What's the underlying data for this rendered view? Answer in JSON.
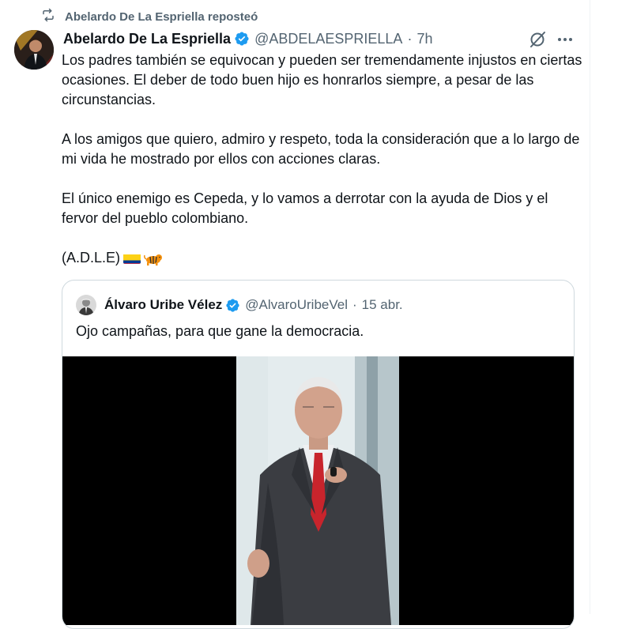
{
  "repost": {
    "label": "Abelardo De La Espriella reposteó",
    "icon": "repost-icon"
  },
  "tweet": {
    "author_name": "Abelardo De La Espriella",
    "handle": "@ABDELAESPRIELLA",
    "separator": "·",
    "time": "7h",
    "paragraphs": [
      "Los padres también se equivocan y pueden ser tremendamente injustos en ciertas ocasiones. El deber de todo buen hijo es honrarlos siempre, a pesar de las circunstancias.",
      "A los amigos que quiero, admiro y respeto, toda la consideración que a lo largo de mi vida he mostrado por ellos con acciones claras.",
      "El único enemigo es Cepeda, y lo vamos a derrotar con la ayuda de Dios y el fervor del pueblo colombiano."
    ],
    "signature": "(A.D.L.E)",
    "emojis": [
      "colombia-flag",
      "tiger"
    ]
  },
  "quoted": {
    "author_name": "Álvaro Uribe Vélez",
    "handle": "@AlvaroUribeVel",
    "separator": "·",
    "date": "15 abr.",
    "text": "Ojo campañas, para que gane la democracia."
  },
  "colors": {
    "verified": "#1d9bf0",
    "secondary_text": "#536471",
    "border": "#cfd9de",
    "media_bg": "#000000"
  }
}
